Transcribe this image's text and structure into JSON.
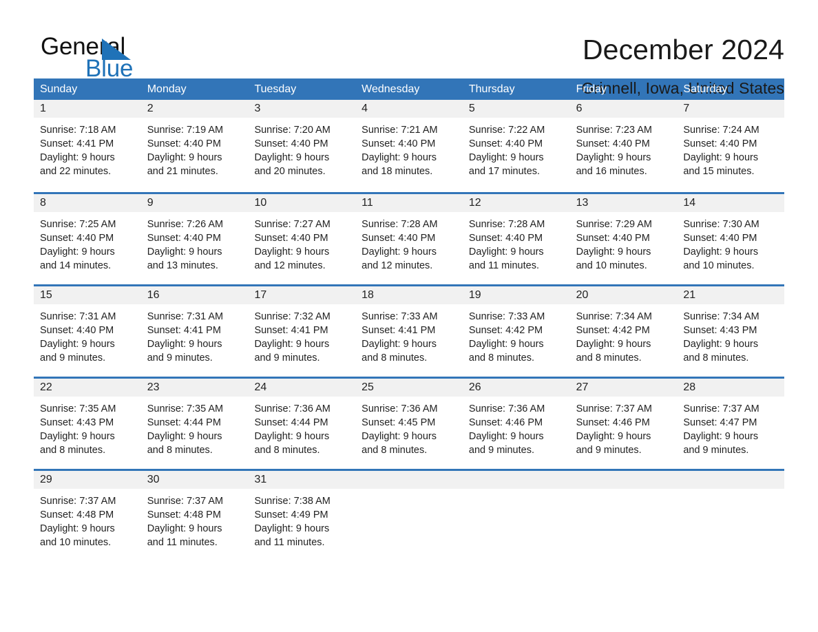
{
  "brand": {
    "name_part1": "General",
    "name_part2": "Blue",
    "accent_color": "#1f72b8"
  },
  "header": {
    "month_title": "December 2024",
    "location": "Grinnell, Iowa, United States"
  },
  "calendar": {
    "header_color": "#3275b8",
    "weekdays": [
      "Sunday",
      "Monday",
      "Tuesday",
      "Wednesday",
      "Thursday",
      "Friday",
      "Saturday"
    ],
    "weeks": [
      [
        {
          "day": "1",
          "sunrise": "Sunrise: 7:18 AM",
          "sunset": "Sunset: 4:41 PM",
          "daylight_line1": "Daylight: 9 hours",
          "daylight_line2": "and 22 minutes."
        },
        {
          "day": "2",
          "sunrise": "Sunrise: 7:19 AM",
          "sunset": "Sunset: 4:40 PM",
          "daylight_line1": "Daylight: 9 hours",
          "daylight_line2": "and 21 minutes."
        },
        {
          "day": "3",
          "sunrise": "Sunrise: 7:20 AM",
          "sunset": "Sunset: 4:40 PM",
          "daylight_line1": "Daylight: 9 hours",
          "daylight_line2": "and 20 minutes."
        },
        {
          "day": "4",
          "sunrise": "Sunrise: 7:21 AM",
          "sunset": "Sunset: 4:40 PM",
          "daylight_line1": "Daylight: 9 hours",
          "daylight_line2": "and 18 minutes."
        },
        {
          "day": "5",
          "sunrise": "Sunrise: 7:22 AM",
          "sunset": "Sunset: 4:40 PM",
          "daylight_line1": "Daylight: 9 hours",
          "daylight_line2": "and 17 minutes."
        },
        {
          "day": "6",
          "sunrise": "Sunrise: 7:23 AM",
          "sunset": "Sunset: 4:40 PM",
          "daylight_line1": "Daylight: 9 hours",
          "daylight_line2": "and 16 minutes."
        },
        {
          "day": "7",
          "sunrise": "Sunrise: 7:24 AM",
          "sunset": "Sunset: 4:40 PM",
          "daylight_line1": "Daylight: 9 hours",
          "daylight_line2": "and 15 minutes."
        }
      ],
      [
        {
          "day": "8",
          "sunrise": "Sunrise: 7:25 AM",
          "sunset": "Sunset: 4:40 PM",
          "daylight_line1": "Daylight: 9 hours",
          "daylight_line2": "and 14 minutes."
        },
        {
          "day": "9",
          "sunrise": "Sunrise: 7:26 AM",
          "sunset": "Sunset: 4:40 PM",
          "daylight_line1": "Daylight: 9 hours",
          "daylight_line2": "and 13 minutes."
        },
        {
          "day": "10",
          "sunrise": "Sunrise: 7:27 AM",
          "sunset": "Sunset: 4:40 PM",
          "daylight_line1": "Daylight: 9 hours",
          "daylight_line2": "and 12 minutes."
        },
        {
          "day": "11",
          "sunrise": "Sunrise: 7:28 AM",
          "sunset": "Sunset: 4:40 PM",
          "daylight_line1": "Daylight: 9 hours",
          "daylight_line2": "and 12 minutes."
        },
        {
          "day": "12",
          "sunrise": "Sunrise: 7:28 AM",
          "sunset": "Sunset: 4:40 PM",
          "daylight_line1": "Daylight: 9 hours",
          "daylight_line2": "and 11 minutes."
        },
        {
          "day": "13",
          "sunrise": "Sunrise: 7:29 AM",
          "sunset": "Sunset: 4:40 PM",
          "daylight_line1": "Daylight: 9 hours",
          "daylight_line2": "and 10 minutes."
        },
        {
          "day": "14",
          "sunrise": "Sunrise: 7:30 AM",
          "sunset": "Sunset: 4:40 PM",
          "daylight_line1": "Daylight: 9 hours",
          "daylight_line2": "and 10 minutes."
        }
      ],
      [
        {
          "day": "15",
          "sunrise": "Sunrise: 7:31 AM",
          "sunset": "Sunset: 4:40 PM",
          "daylight_line1": "Daylight: 9 hours",
          "daylight_line2": "and 9 minutes."
        },
        {
          "day": "16",
          "sunrise": "Sunrise: 7:31 AM",
          "sunset": "Sunset: 4:41 PM",
          "daylight_line1": "Daylight: 9 hours",
          "daylight_line2": "and 9 minutes."
        },
        {
          "day": "17",
          "sunrise": "Sunrise: 7:32 AM",
          "sunset": "Sunset: 4:41 PM",
          "daylight_line1": "Daylight: 9 hours",
          "daylight_line2": "and 9 minutes."
        },
        {
          "day": "18",
          "sunrise": "Sunrise: 7:33 AM",
          "sunset": "Sunset: 4:41 PM",
          "daylight_line1": "Daylight: 9 hours",
          "daylight_line2": "and 8 minutes."
        },
        {
          "day": "19",
          "sunrise": "Sunrise: 7:33 AM",
          "sunset": "Sunset: 4:42 PM",
          "daylight_line1": "Daylight: 9 hours",
          "daylight_line2": "and 8 minutes."
        },
        {
          "day": "20",
          "sunrise": "Sunrise: 7:34 AM",
          "sunset": "Sunset: 4:42 PM",
          "daylight_line1": "Daylight: 9 hours",
          "daylight_line2": "and 8 minutes."
        },
        {
          "day": "21",
          "sunrise": "Sunrise: 7:34 AM",
          "sunset": "Sunset: 4:43 PM",
          "daylight_line1": "Daylight: 9 hours",
          "daylight_line2": "and 8 minutes."
        }
      ],
      [
        {
          "day": "22",
          "sunrise": "Sunrise: 7:35 AM",
          "sunset": "Sunset: 4:43 PM",
          "daylight_line1": "Daylight: 9 hours",
          "daylight_line2": "and 8 minutes."
        },
        {
          "day": "23",
          "sunrise": "Sunrise: 7:35 AM",
          "sunset": "Sunset: 4:44 PM",
          "daylight_line1": "Daylight: 9 hours",
          "daylight_line2": "and 8 minutes."
        },
        {
          "day": "24",
          "sunrise": "Sunrise: 7:36 AM",
          "sunset": "Sunset: 4:44 PM",
          "daylight_line1": "Daylight: 9 hours",
          "daylight_line2": "and 8 minutes."
        },
        {
          "day": "25",
          "sunrise": "Sunrise: 7:36 AM",
          "sunset": "Sunset: 4:45 PM",
          "daylight_line1": "Daylight: 9 hours",
          "daylight_line2": "and 8 minutes."
        },
        {
          "day": "26",
          "sunrise": "Sunrise: 7:36 AM",
          "sunset": "Sunset: 4:46 PM",
          "daylight_line1": "Daylight: 9 hours",
          "daylight_line2": "and 9 minutes."
        },
        {
          "day": "27",
          "sunrise": "Sunrise: 7:37 AM",
          "sunset": "Sunset: 4:46 PM",
          "daylight_line1": "Daylight: 9 hours",
          "daylight_line2": "and 9 minutes."
        },
        {
          "day": "28",
          "sunrise": "Sunrise: 7:37 AM",
          "sunset": "Sunset: 4:47 PM",
          "daylight_line1": "Daylight: 9 hours",
          "daylight_line2": "and 9 minutes."
        }
      ],
      [
        {
          "day": "29",
          "sunrise": "Sunrise: 7:37 AM",
          "sunset": "Sunset: 4:48 PM",
          "daylight_line1": "Daylight: 9 hours",
          "daylight_line2": "and 10 minutes."
        },
        {
          "day": "30",
          "sunrise": "Sunrise: 7:37 AM",
          "sunset": "Sunset: 4:48 PM",
          "daylight_line1": "Daylight: 9 hours",
          "daylight_line2": "and 11 minutes."
        },
        {
          "day": "31",
          "sunrise": "Sunrise: 7:38 AM",
          "sunset": "Sunset: 4:49 PM",
          "daylight_line1": "Daylight: 9 hours",
          "daylight_line2": "and 11 minutes."
        },
        {
          "day": "",
          "sunrise": "",
          "sunset": "",
          "daylight_line1": "",
          "daylight_line2": ""
        },
        {
          "day": "",
          "sunrise": "",
          "sunset": "",
          "daylight_line1": "",
          "daylight_line2": ""
        },
        {
          "day": "",
          "sunrise": "",
          "sunset": "",
          "daylight_line1": "",
          "daylight_line2": ""
        },
        {
          "day": "",
          "sunrise": "",
          "sunset": "",
          "daylight_line1": "",
          "daylight_line2": ""
        }
      ]
    ]
  }
}
